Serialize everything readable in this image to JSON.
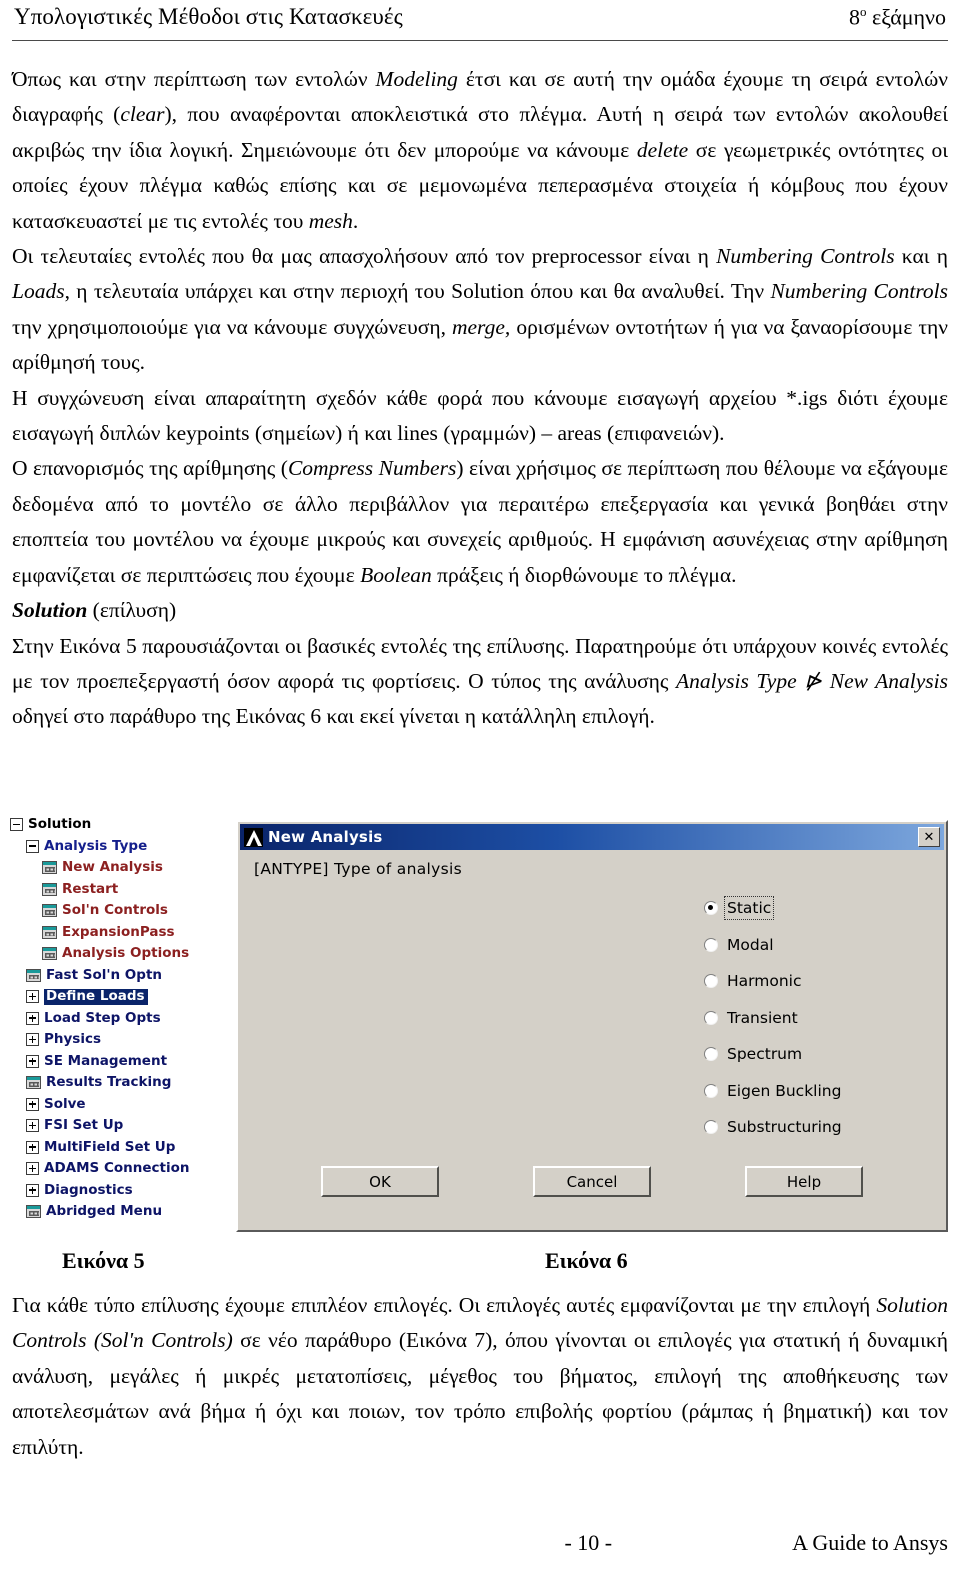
{
  "header": {
    "left": "Υπολογιστικές Μέθοδοι στις Κατασκευές",
    "right_number": "8",
    "right_sup": "ο",
    "right_word": " εξάμηνο"
  },
  "body": {
    "p1_a": "Όπως και στην περίπτωση των εντολών ",
    "p1_i1": "Modeling",
    "p1_b": " έτσι και σε αυτή την ομάδα έχουμε τη σειρά εντολών διαγραφής (",
    "p1_i2": "clear",
    "p1_c": "), που αναφέρονται αποκλειστικά στο πλέγμα.  Αυτή η σειρά των εντολών ακολουθεί ακριβώς την ίδια λογική. Σημειώνουμε ότι δεν μπορούμε να κάνουμε ",
    "p1_i3": "delete",
    "p1_d": " σε γεωμετρικές οντότητες οι οποίες έχουν πλέγμα καθώς επίσης και σε μεμονωμένα πεπερασμένα στοιχεία ή κόμβους που έχουν κατασκευαστεί με τις εντολές του ",
    "p1_i4": "mesh",
    "p1_e": ".",
    "p2_a": "Οι τελευταίες εντολές που θα μας απασχολήσουν από τον preprocessor είναι η ",
    "p2_i1": "Numbering Controls",
    "p2_b": " και η ",
    "p2_i2": "Loads",
    "p2_c": ", η τελευταία υπάρχει και στην περιοχή του Solution όπου και θα αναλυθεί. Την ",
    "p2_i3": "Numbering Controls",
    "p2_d": " την χρησιμοποιούμε για να κάνουμε συγχώνευση, ",
    "p2_i4": "merge,",
    "p2_e": " ορισμένων οντοτήτων ή για να ξαναορίσουμε την αρίθμησή τους.",
    "p3": "Η συγχώνευση είναι απαραίτητη σχεδόν κάθε φορά που κάνουμε εισαγωγή αρχείου *.igs διότι έχουμε εισαγωγή διπλών keypoints (σημείων) ή και lines (γραμμών) – areas (επιφανειών).",
    "p4_a": "Ο επανορισμός της αρίθμησης (",
    "p4_i1": "Compress Numbers",
    "p4_b": ") είναι χρήσιμος σε περίπτωση που θέλουμε να εξάγουμε δεδομένα από το μοντέλο σε άλλο περιβάλλον για περαιτέρω επεξεργασία και γενικά βοηθάει στην εποπτεία του μοντέλου να έχουμε μικρούς και συνεχείς αριθμούς. Η εμφάνιση ασυνέχειας στην αρίθμηση εμφανίζεται σε περιπτώσεις που έχουμε ",
    "p4_i2": "Boolean",
    "p4_c": " πράξεις ή διορθώνουμε το πλέγμα.",
    "p5_heading": "Solution",
    "p5_rest": " (επίλυση)",
    "p6_a": "Στην Εικόνα 5 παρουσιάζονται οι βασικές εντολές της επίλυσης. Παρατηρούμε ότι υπάρχουν κοινές εντολές με τον προεπεξεργαστή όσον αφορά τις φορτίσεις. Ο τύπος της ανάλυσης ",
    "p6_i1": "Analysis Type",
    "p6_b": " ⋫ ",
    "p6_i2": "New Analysis",
    "p6_c": " οδηγεί στο παράθυρο της Εικόνας 6 και εκεί γίνεται η κατάλληλη επιλογή.",
    "p7_a": "Για κάθε τύπο επίλυσης έχουμε επιπλέον επιλογές. Οι επιλογές αυτές εμφανίζονται με την επιλογή ",
    "p7_i1": "Solution Controls (Sol'n Controls)",
    "p7_b": " σε νέο παράθυρο (Εικόνα 7), όπου γίνονται οι επιλογές για στατική ή δυναμική ανάλυση, μεγάλες ή μικρές μετατοπίσεις, μέγεθος του βήματος, επιλογή της αποθήκευσης των αποτελεσμάτων ανά βήμα ή όχι και ποιων, τον τρόπο επιβολής φορτίου (ράμπας ή βηματική) και τον επιλύτη."
  },
  "tree": {
    "items": [
      {
        "label": "Solution",
        "level": 0,
        "marker": "minus",
        "color": "c-black",
        "selected": false
      },
      {
        "label": "Analysis Type",
        "level": 1,
        "marker": "minus",
        "color": "c-navy",
        "selected": false
      },
      {
        "label": "New Analysis",
        "level": 2,
        "marker": "icon",
        "color": "c-maroon",
        "selected": false
      },
      {
        "label": "Restart",
        "level": 2,
        "marker": "icon",
        "color": "c-maroon",
        "selected": false
      },
      {
        "label": "Sol'n Controls",
        "level": 2,
        "marker": "icon",
        "color": "c-maroon",
        "selected": false
      },
      {
        "label": "ExpansionPass",
        "level": 2,
        "marker": "icon",
        "color": "c-maroon",
        "selected": false
      },
      {
        "label": "Analysis Options",
        "level": 2,
        "marker": "icon",
        "color": "c-maroon",
        "selected": false
      },
      {
        "label": "Fast Sol'n Optn",
        "level": 1,
        "marker": "icon",
        "color": "c-dnavy",
        "selected": false
      },
      {
        "label": "Define Loads",
        "level": 1,
        "marker": "plus",
        "color": "c-dnavy",
        "selected": true
      },
      {
        "label": "Load Step Opts",
        "level": 1,
        "marker": "plus",
        "color": "c-dnavy",
        "selected": false
      },
      {
        "label": "Physics",
        "level": 1,
        "marker": "plus",
        "color": "c-dnavy",
        "selected": false
      },
      {
        "label": "SE Management",
        "level": 1,
        "marker": "plus",
        "color": "c-dnavy",
        "selected": false
      },
      {
        "label": "Results Tracking",
        "level": 1,
        "marker": "icon",
        "color": "c-dnavy",
        "selected": false
      },
      {
        "label": "Solve",
        "level": 1,
        "marker": "plus",
        "color": "c-dnavy",
        "selected": false
      },
      {
        "label": "FSI Set Up",
        "level": 1,
        "marker": "plus",
        "color": "c-dnavy",
        "selected": false
      },
      {
        "label": "MultiField Set Up",
        "level": 1,
        "marker": "plus",
        "color": "c-dnavy",
        "selected": false
      },
      {
        "label": "ADAMS Connection",
        "level": 1,
        "marker": "plus",
        "color": "c-dnavy",
        "selected": false
      },
      {
        "label": "Diagnostics",
        "level": 1,
        "marker": "plus",
        "color": "c-dnavy",
        "selected": false
      },
      {
        "label": "Abridged Menu",
        "level": 1,
        "marker": "icon",
        "color": "c-dnavy",
        "selected": false
      }
    ]
  },
  "dialog": {
    "title": "New Analysis",
    "close_label": "✕",
    "prompt": "[ANTYPE]   Type of analysis",
    "options": [
      {
        "label": "Static",
        "selected": true,
        "focused": true
      },
      {
        "label": "Modal",
        "selected": false,
        "focused": false
      },
      {
        "label": "Harmonic",
        "selected": false,
        "focused": false
      },
      {
        "label": "Transient",
        "selected": false,
        "focused": false
      },
      {
        "label": "Spectrum",
        "selected": false,
        "focused": false
      },
      {
        "label": "Eigen Buckling",
        "selected": false,
        "focused": false
      },
      {
        "label": "Substructuring",
        "selected": false,
        "focused": false
      }
    ],
    "buttons": [
      {
        "label": "OK"
      },
      {
        "label": "Cancel"
      },
      {
        "label": "Help"
      }
    ]
  },
  "captions": {
    "figure5": "Εικόνα 5",
    "figure6": "Εικόνα 6"
  },
  "footer": {
    "page_number": "- 10 -",
    "guide": "A Guide to Ansys"
  },
  "colors": {
    "dialog_face": "#d4d0c8",
    "title_start": "#0a246a",
    "title_end": "#7da7dd",
    "selection": "#0a246a",
    "tree_navy": "#141f8c",
    "tree_maroon": "#8c2020"
  }
}
